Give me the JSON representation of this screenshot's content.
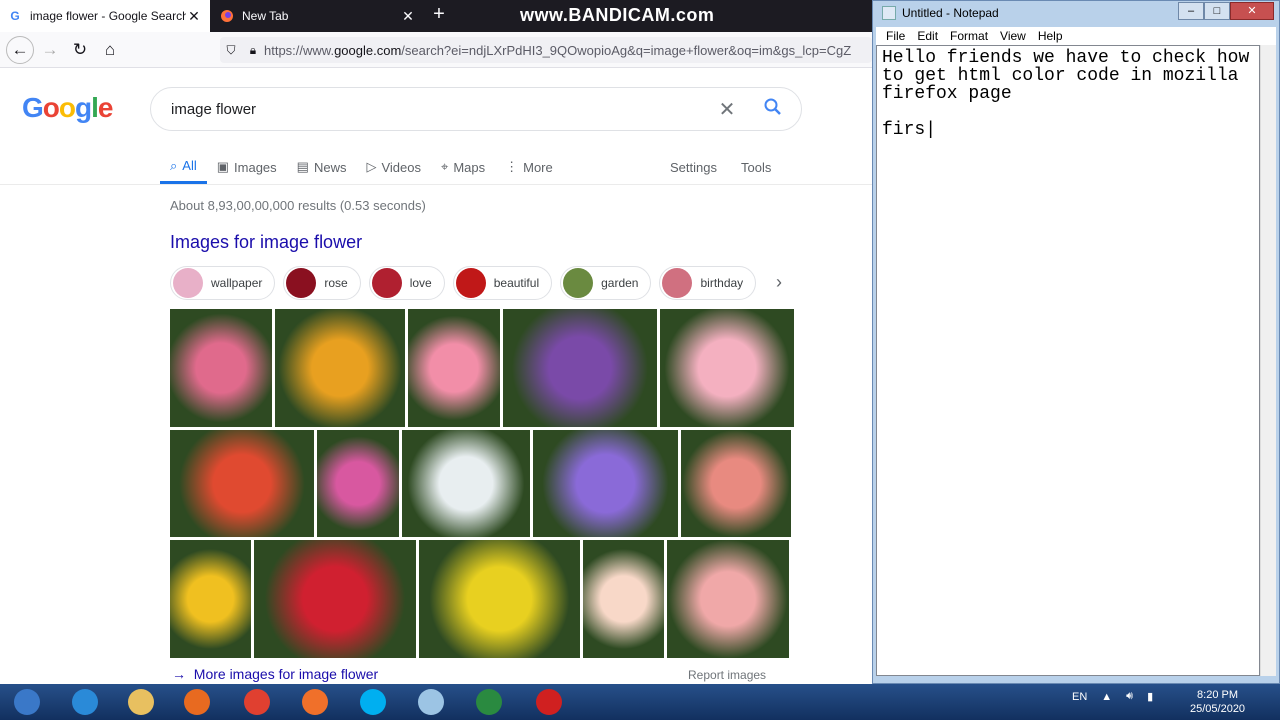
{
  "browser": {
    "tabs": [
      {
        "title": "image flower - Google Search",
        "favicon": "G"
      },
      {
        "title": "New Tab"
      }
    ],
    "watermark": "www.BANDICAM.com",
    "url_prefix": "https://www.",
    "url_domain": "google.com",
    "url_rest": "/search?ei=ndjLXrPdHI3_9QOwopioAg&q=image+flower&oq=im&gs_lcp=CgZ"
  },
  "google": {
    "logo": [
      "G",
      "o",
      "o",
      "g",
      "l",
      "e"
    ],
    "logo_colors": [
      "#4285f4",
      "#ea4335",
      "#fbbc05",
      "#4285f4",
      "#34a853",
      "#ea4335"
    ],
    "query": "image flower",
    "tabs": [
      "All",
      "Images",
      "News",
      "Videos",
      "Maps",
      "More"
    ],
    "settings": "Settings",
    "tools": "Tools",
    "stats": "About 8,93,00,00,000 results (0.53 seconds)",
    "images_heading": "Images for image flower",
    "chips": [
      {
        "label": "wallpaper",
        "color": "#e8b0c8"
      },
      {
        "label": "rose",
        "color": "#8a1020"
      },
      {
        "label": "love",
        "color": "#b02030"
      },
      {
        "label": "beautiful",
        "color": "#c01818"
      },
      {
        "label": "garden",
        "color": "#6a8a40"
      },
      {
        "label": "birthday",
        "color": "#d07080"
      }
    ],
    "more_images": "More images for image flower",
    "report": "Report images",
    "image_colors": [
      "#e06a8c",
      "#e8a020",
      "#f28ea8",
      "#7a4aa8",
      "#f4b0c0",
      "#e04a30",
      "#d858a0",
      "#e8eef0",
      "#8a6ad8",
      "#e88a80",
      "#f0c020",
      "#d02030",
      "#e8d020",
      "#f8d8c8",
      "#f0a8a8"
    ]
  },
  "notepad": {
    "title": "Untitled - Notepad",
    "menu": [
      "File",
      "Edit",
      "Format",
      "View",
      "Help"
    ],
    "text": "Hello friends we have to check how\nto get html color code in mozilla\nfirefox page\n\nfirs|"
  },
  "taskbar": {
    "apps": [
      {
        "name": "start-orb",
        "color": "#3a78c8"
      },
      {
        "name": "ie-icon",
        "color": "#2a8ad8"
      },
      {
        "name": "file-explorer-icon",
        "color": "#e8c060"
      },
      {
        "name": "media-player-icon",
        "color": "#e86a20"
      },
      {
        "name": "chrome-icon",
        "color": "#e04030"
      },
      {
        "name": "firefox-icon",
        "color": "#f0702a"
      },
      {
        "name": "skype-icon",
        "color": "#00aff0"
      },
      {
        "name": "notepad-icon",
        "color": "#9cc4e4"
      },
      {
        "name": "excel-icon",
        "color": "#2a8a40"
      },
      {
        "name": "bandicam-icon",
        "color": "#d02020"
      }
    ],
    "lang": "EN",
    "time": "8:20 PM",
    "date": "25/05/2020"
  }
}
